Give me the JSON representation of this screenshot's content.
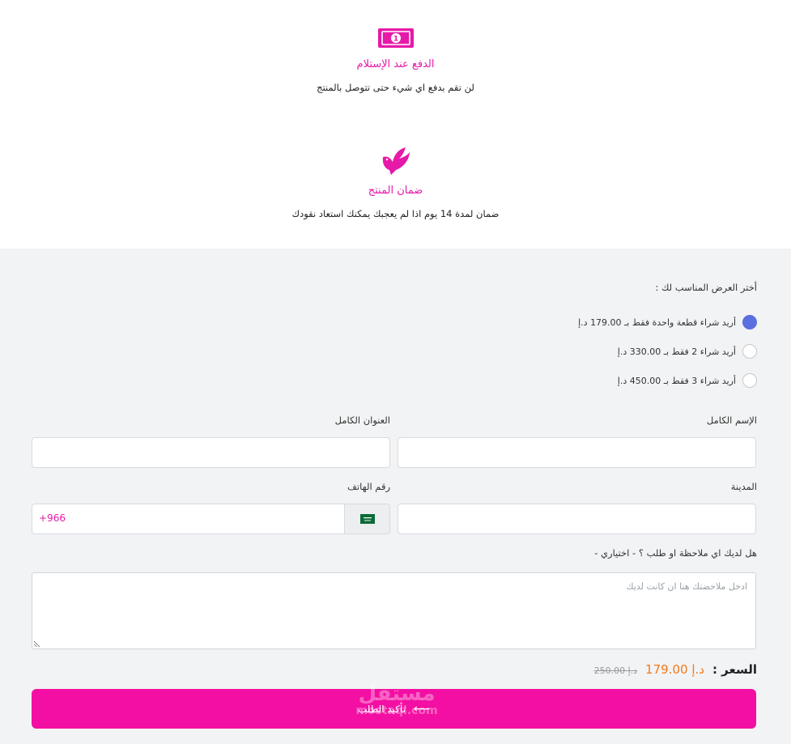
{
  "features": [
    {
      "icon": "cash-icon",
      "title": "الدفع عند الإستلام",
      "description": "لن تقم بدفع اي شيء حتى تتوصل بالمنتج"
    },
    {
      "icon": "dove-icon",
      "title": "ضمان المنتج",
      "description": "ضمان لمدة 14 يوم اذا لم يعجبك يمكنك استعاد نقودك"
    }
  ],
  "offers": {
    "label": "أختر العرض المناسب لك :",
    "options": [
      {
        "text": "أريد شراء قطعة واحدة فقط بـ 179.00 د.إ",
        "selected": true
      },
      {
        "text": "أريد شراء 2 فقط بـ 330.00 د.إ",
        "selected": false
      },
      {
        "text": "أريد شراء 3 فقط بـ 450.00 د.إ",
        "selected": false
      }
    ]
  },
  "form": {
    "full_name_label": "الإسم الكامل",
    "full_address_label": "العنوان الكامل",
    "city_label": "المدينة",
    "phone_label": "رقم الهاتف",
    "phone_code": "+966",
    "notes_label": "هل لديك اي ملاحظة او طلب ؟ - اختياري -",
    "notes_placeholder": "ادخل ملاحضتك هنا ان كانت لديك"
  },
  "price": {
    "label": "السعر :",
    "current": "179.00 د.إ",
    "old": "250.00 د.إ"
  },
  "submit_label": "تأكيد الطلب",
  "watermark": {
    "arabic": "مستقل",
    "latin": "mostaql.com"
  },
  "colors": {
    "accent": "#f30fa3",
    "radio": "#5a6fe0",
    "price": "#f07a1a"
  }
}
